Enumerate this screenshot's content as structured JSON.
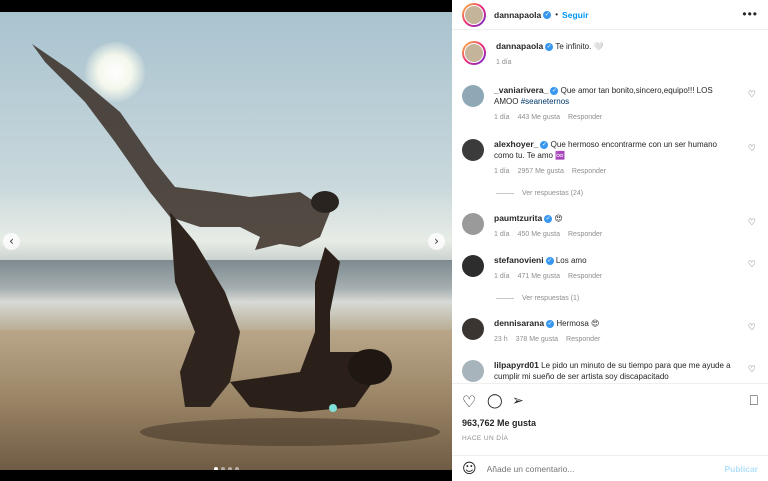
{
  "post": {
    "username": "dannapaola",
    "follow_label": "Seguir",
    "more_label": "•••",
    "caption": "Te infinito. 🤍",
    "caption_time": "1 día",
    "likes": "963,762 Me gusta",
    "time_ago": "HACE UN DÍA"
  },
  "comments": [
    {
      "user": "_vaniarivera_",
      "text": "Que amor tan bonito,sincero,equipo!!! LOS AMOO",
      "tag": "#seaneternos",
      "time": "1 día",
      "likes": "443 Me gusta",
      "reply": "Responder"
    },
    {
      "user": "alexhoyer_",
      "text": "Que hermoso encontrarme con un ser humano como tu. Te amo ♾️",
      "time": "1 día",
      "likes": "2957 Me gusta",
      "reply": "Responder",
      "replies": "Ver respuestas (24)"
    },
    {
      "user": "paumtzurita",
      "text": "😍",
      "time": "1 día",
      "likes": "450 Me gusta",
      "reply": "Responder"
    },
    {
      "user": "stefanovieni",
      "text": "Los amo",
      "time": "1 día",
      "likes": "471 Me gusta",
      "reply": "Responder",
      "replies": "Ver respuestas (1)"
    },
    {
      "user": "dennisarana",
      "text": "Hermosa 😍",
      "time": "23 h",
      "likes": "378 Me gusta",
      "reply": "Responder"
    },
    {
      "user": "lilpapyrd01",
      "text": "Le pido un minuto de su tiempo para que me ayude a cumplir mi sueño de ser artista soy discapacitado"
    }
  ],
  "composer": {
    "placeholder": "Añade un comentario...",
    "post_label": "Publicar"
  },
  "icons": {
    "prev": "‹",
    "next": "›",
    "heart": "♡",
    "comment": "◯",
    "share": "➢",
    "save": "⎕",
    "emoji": "☺"
  },
  "colors": {
    "accent": "#0095f6",
    "verified": "#3897f0",
    "muted": "#8e8e8e"
  }
}
